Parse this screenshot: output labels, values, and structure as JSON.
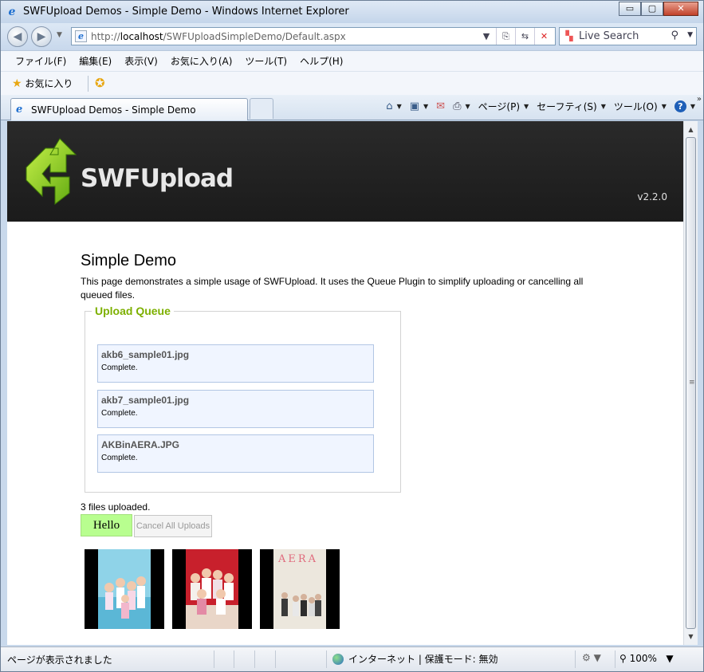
{
  "window": {
    "title": "SWFUpload Demos - Simple Demo - Windows Internet Explorer",
    "buttons": {
      "minimize": "▭",
      "maximize": "▢",
      "close": "✕"
    }
  },
  "address_bar": {
    "url_prefix": "http://",
    "url_host": "localhost",
    "url_path": "/SWFUploadSimpleDemo/Default.aspx"
  },
  "search": {
    "placeholder": "Live Search"
  },
  "menu": [
    "ファイル(F)",
    "編集(E)",
    "表示(V)",
    "お気に入り(A)",
    "ツール(T)",
    "ヘルプ(H)"
  ],
  "favorites": {
    "label": "お気に入り"
  },
  "tabs": [
    {
      "label": "SWFUpload Demos - Simple Demo"
    }
  ],
  "command_bar": {
    "page": "ページ(P)",
    "safety": "セーフティ(S)",
    "tools": "ツール(O)"
  },
  "page": {
    "logo": "SWFUpload",
    "version": "v2.2.0",
    "title": "Simple Demo",
    "intro": "This page demonstrates a simple usage of SWFUpload. It uses the Queue Plugin to simplify uploading or cancelling all queued files.",
    "queue_legend": "Upload Queue",
    "queue": [
      {
        "name": "akb6_sample01.jpg",
        "status": "Complete."
      },
      {
        "name": "akb7_sample01.jpg",
        "status": "Complete."
      },
      {
        "name": "AKBinAERA.JPG",
        "status": "Complete."
      }
    ],
    "uploaded_text": "3 files uploaded.",
    "hello_button": "Hello",
    "cancel_button": "Cancel All Uploads",
    "thumbnails": [
      {
        "name": "akb6_sample01-thumb",
        "bg": "#8fd3e8"
      },
      {
        "name": "akb7_sample01-thumb",
        "bg": "#c8202c"
      },
      {
        "name": "AKBinAERA-thumb",
        "bg": "#ece7dd"
      }
    ]
  },
  "status_bar": {
    "message": "ページが表示されました",
    "zone": "インターネット | 保護モード: 無効",
    "zoom": "100%"
  },
  "colors": {
    "accent_green": "#7db000",
    "hello_bg": "#b8fe8f",
    "queue_item_bg": "#f0f5ff",
    "header_bg": "#222222"
  }
}
